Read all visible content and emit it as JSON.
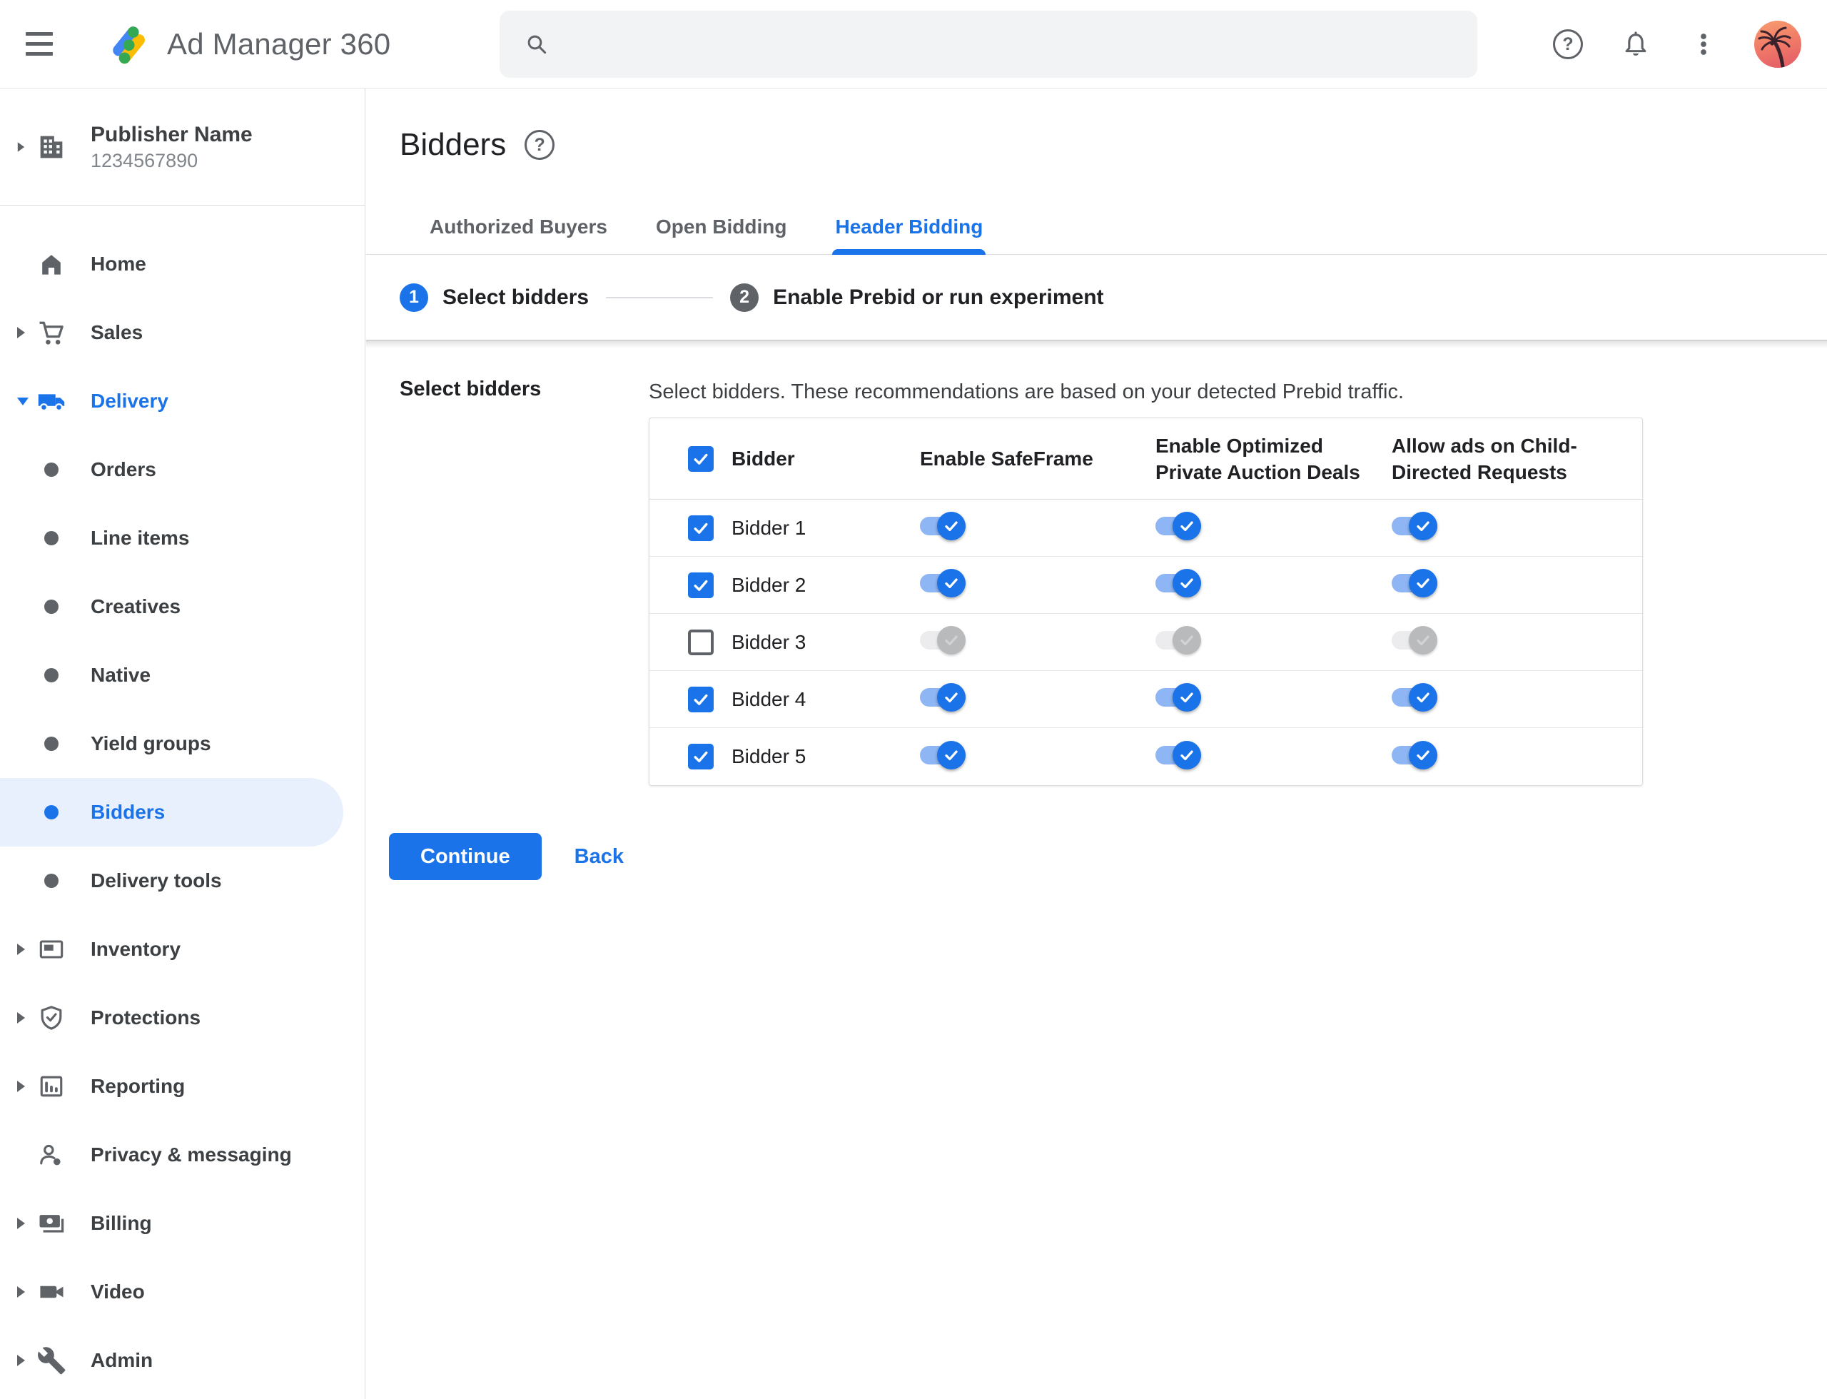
{
  "header": {
    "app_name": "Ad Manager 360",
    "search": {
      "value": "",
      "placeholder": ""
    }
  },
  "sidebar": {
    "publisher": {
      "name": "Publisher Name",
      "id": "1234567890"
    },
    "items": [
      {
        "label": "Home",
        "level": "top",
        "icon": "home-icon",
        "arrow": "none",
        "state": "default"
      },
      {
        "label": "Sales",
        "level": "top",
        "icon": "cart-icon",
        "arrow": "collapsed",
        "state": "default"
      },
      {
        "label": "Delivery",
        "level": "top",
        "icon": "truck-icon",
        "arrow": "expanded",
        "state": "section-active"
      },
      {
        "label": "Orders",
        "level": "sub",
        "state": "default"
      },
      {
        "label": "Line items",
        "level": "sub",
        "state": "default"
      },
      {
        "label": "Creatives",
        "level": "sub",
        "state": "default"
      },
      {
        "label": "Native",
        "level": "sub",
        "state": "default"
      },
      {
        "label": "Yield groups",
        "level": "sub",
        "state": "default"
      },
      {
        "label": "Bidders",
        "level": "sub",
        "state": "selected"
      },
      {
        "label": "Delivery tools",
        "level": "sub",
        "state": "default"
      },
      {
        "label": "Inventory",
        "level": "top",
        "icon": "inventory-icon",
        "arrow": "collapsed",
        "state": "default"
      },
      {
        "label": "Protections",
        "level": "top",
        "icon": "shield-check-icon",
        "arrow": "collapsed",
        "state": "default"
      },
      {
        "label": "Reporting",
        "level": "top",
        "icon": "bar-chart-icon",
        "arrow": "collapsed",
        "state": "default"
      },
      {
        "label": "Privacy & messaging",
        "level": "top",
        "icon": "person-privacy-icon",
        "arrow": "none",
        "state": "default"
      },
      {
        "label": "Billing",
        "level": "top",
        "icon": "payments-icon",
        "arrow": "collapsed",
        "state": "default"
      },
      {
        "label": "Video",
        "level": "top",
        "icon": "videocam-icon",
        "arrow": "collapsed",
        "state": "default"
      },
      {
        "label": "Admin",
        "level": "top",
        "icon": "wrench-icon",
        "arrow": "collapsed",
        "state": "default"
      }
    ]
  },
  "page": {
    "title": "Bidders"
  },
  "tabs": {
    "active": "Header Bidding",
    "items": [
      {
        "label": "Authorized Buyers"
      },
      {
        "label": "Open Bidding"
      },
      {
        "label": "Header Bidding"
      }
    ]
  },
  "stepper": {
    "steps": [
      {
        "number": "1",
        "label": "Select bidders",
        "state": "active"
      },
      {
        "number": "2",
        "label": "Enable Prebid or run experiment",
        "state": "upcoming"
      }
    ]
  },
  "content": {
    "section_label": "Select bidders",
    "description": "Select bidders. These recommendations are based on your detected Prebid traffic.",
    "table": {
      "select_all_checked": true,
      "columns": [
        "Bidder",
        "Enable SafeFrame",
        "Enable Optimized Private Auction Deals",
        "Allow ads on Child-Directed Requests"
      ],
      "rows": [
        {
          "name": "Bidder 1",
          "selected": true,
          "toggles_enabled": true,
          "enable_safeframe": true,
          "enable_optimized_private_auction_deals": true,
          "allow_ads_on_child_directed_requests": true
        },
        {
          "name": "Bidder 2",
          "selected": true,
          "toggles_enabled": true,
          "enable_safeframe": true,
          "enable_optimized_private_auction_deals": true,
          "allow_ads_on_child_directed_requests": true
        },
        {
          "name": "Bidder 3",
          "selected": false,
          "toggles_enabled": false,
          "enable_safeframe": true,
          "enable_optimized_private_auction_deals": true,
          "allow_ads_on_child_directed_requests": true
        },
        {
          "name": "Bidder 4",
          "selected": true,
          "toggles_enabled": true,
          "enable_safeframe": true,
          "enable_optimized_private_auction_deals": true,
          "allow_ads_on_child_directed_requests": true
        },
        {
          "name": "Bidder 5",
          "selected": true,
          "toggles_enabled": true,
          "enable_safeframe": true,
          "enable_optimized_private_auction_deals": true,
          "allow_ads_on_child_directed_requests": true
        }
      ]
    },
    "actions": {
      "continue_label": "Continue",
      "back_label": "Back"
    }
  },
  "colors": {
    "accent": "#1a73e8",
    "selected_item_bg": "#e8f0fe",
    "toggle_on_track": "#8fb6f4",
    "toggle_off_thumb": "#b9babc",
    "text_primary": "#202124",
    "text_secondary": "#5f6368",
    "divider": "#dadce0"
  }
}
